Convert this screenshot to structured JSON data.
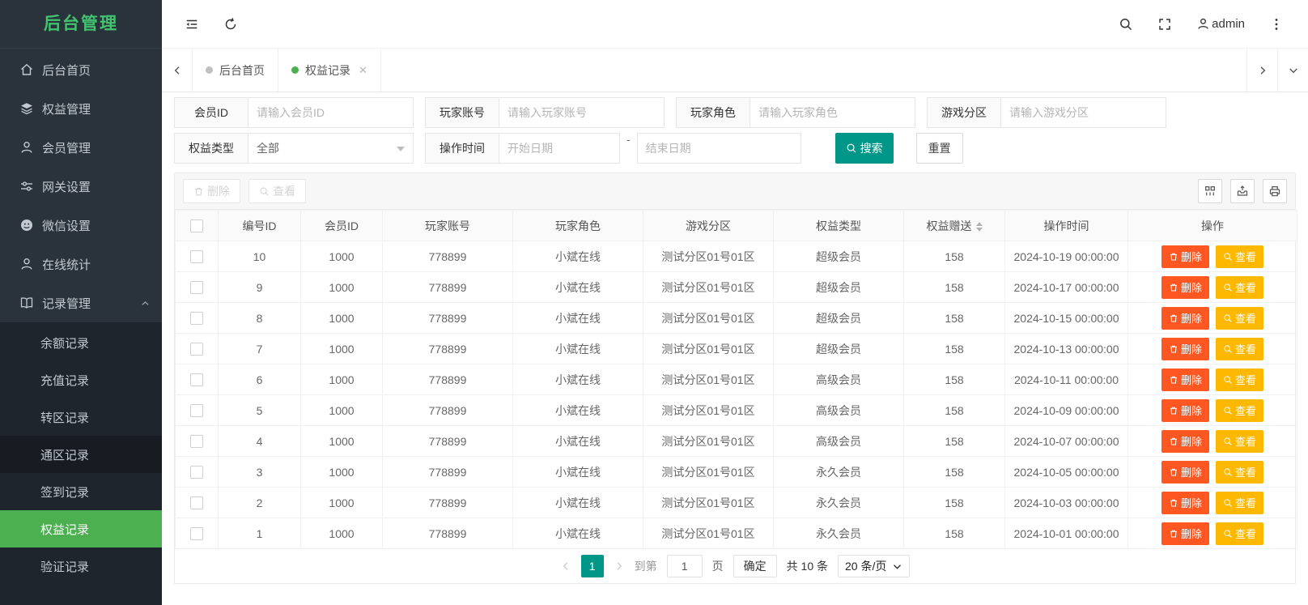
{
  "sidebar": {
    "title": "后台管理",
    "menu": [
      {
        "label": "后台首页",
        "icon": "home-icon"
      },
      {
        "label": "权益管理",
        "icon": "layers-icon"
      },
      {
        "label": "会员管理",
        "icon": "user-icon"
      },
      {
        "label": "网关设置",
        "icon": "sliders-icon"
      },
      {
        "label": "微信设置",
        "icon": "wechat-icon"
      },
      {
        "label": "在线统计",
        "icon": "user-icon"
      },
      {
        "label": "记录管理",
        "icon": "book-icon",
        "expanded": true
      }
    ],
    "submenu": [
      {
        "label": "余额记录"
      },
      {
        "label": "充值记录"
      },
      {
        "label": "转区记录"
      },
      {
        "label": "通区记录",
        "hovered": true
      },
      {
        "label": "签到记录"
      },
      {
        "label": "权益记录",
        "active": true
      },
      {
        "label": "验证记录"
      }
    ]
  },
  "topbar": {
    "username": "admin"
  },
  "tabbar": {
    "tabs": [
      {
        "label": "后台首页",
        "active": false,
        "closable": false
      },
      {
        "label": "权益记录",
        "active": true,
        "closable": true
      }
    ]
  },
  "search_form": {
    "fields": [
      {
        "label": "会员ID",
        "placeholder": "请输入会员ID"
      },
      {
        "label": "玩家账号",
        "placeholder": "请输入玩家账号"
      },
      {
        "label": "玩家角色",
        "placeholder": "请输入玩家角色"
      },
      {
        "label": "游戏分区",
        "placeholder": "请输入游戏分区"
      },
      {
        "label": "权益类型",
        "value": "全部"
      },
      {
        "label": "操作时间",
        "start_placeholder": "开始日期",
        "separator": "-",
        "end_placeholder": "结束日期"
      }
    ],
    "search_label": "搜索",
    "reset_label": "重置"
  },
  "toolbar": {
    "delete_label": "删除",
    "view_label": "查看",
    "icon_buttons": [
      "columns-icon",
      "export-icon",
      "print-icon"
    ]
  },
  "table": {
    "headers": [
      "编号ID",
      "会员ID",
      "玩家账号",
      "玩家角色",
      "游戏分区",
      "权益类型",
      "权益赠送",
      "操作时间",
      "操作"
    ],
    "sortable_column": "权益赠送",
    "row_delete_label": "删除",
    "row_view_label": "查看",
    "rows": [
      {
        "id": "10",
        "member_id": "1000",
        "account": "778899",
        "role": "小斌在线",
        "zone": "测试分区01号01区",
        "type": "超级会员",
        "gift": "158",
        "time": "2024-10-19 00:00:00"
      },
      {
        "id": "9",
        "member_id": "1000",
        "account": "778899",
        "role": "小斌在线",
        "zone": "测试分区01号01区",
        "type": "超级会员",
        "gift": "158",
        "time": "2024-10-17 00:00:00"
      },
      {
        "id": "8",
        "member_id": "1000",
        "account": "778899",
        "role": "小斌在线",
        "zone": "测试分区01号01区",
        "type": "超级会员",
        "gift": "158",
        "time": "2024-10-15 00:00:00"
      },
      {
        "id": "7",
        "member_id": "1000",
        "account": "778899",
        "role": "小斌在线",
        "zone": "测试分区01号01区",
        "type": "超级会员",
        "gift": "158",
        "time": "2024-10-13 00:00:00"
      },
      {
        "id": "6",
        "member_id": "1000",
        "account": "778899",
        "role": "小斌在线",
        "zone": "测试分区01号01区",
        "type": "高级会员",
        "gift": "158",
        "time": "2024-10-11 00:00:00"
      },
      {
        "id": "5",
        "member_id": "1000",
        "account": "778899",
        "role": "小斌在线",
        "zone": "测试分区01号01区",
        "type": "高级会员",
        "gift": "158",
        "time": "2024-10-09 00:00:00"
      },
      {
        "id": "4",
        "member_id": "1000",
        "account": "778899",
        "role": "小斌在线",
        "zone": "测试分区01号01区",
        "type": "高级会员",
        "gift": "158",
        "time": "2024-10-07 00:00:00"
      },
      {
        "id": "3",
        "member_id": "1000",
        "account": "778899",
        "role": "小斌在线",
        "zone": "测试分区01号01区",
        "type": "永久会员",
        "gift": "158",
        "time": "2024-10-05 00:00:00"
      },
      {
        "id": "2",
        "member_id": "1000",
        "account": "778899",
        "role": "小斌在线",
        "zone": "测试分区01号01区",
        "type": "永久会员",
        "gift": "158",
        "time": "2024-10-03 00:00:00"
      },
      {
        "id": "1",
        "member_id": "1000",
        "account": "778899",
        "role": "小斌在线",
        "zone": "测试分区01号01区",
        "type": "永久会员",
        "gift": "158",
        "time": "2024-10-01 00:00:00"
      }
    ]
  },
  "pagination": {
    "current_page": "1",
    "goto_prefix": "到第",
    "goto_value": "1",
    "goto_suffix": "页",
    "confirm_label": "确定",
    "total_text": "共 10 条",
    "page_size": "20 条/页"
  },
  "colors": {
    "brand_green": "#42c46f",
    "menu_active": "#4caf50",
    "primary": "#009688",
    "danger": "#ff5722",
    "warning": "#ffb800"
  }
}
